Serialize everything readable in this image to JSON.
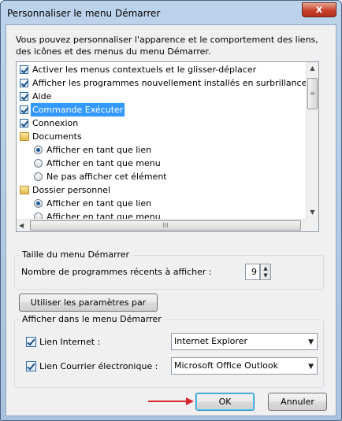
{
  "window": {
    "title": "Personnaliser le menu Démarrer",
    "close_label": "x"
  },
  "description": "Vous pouvez personnaliser l'apparence et le comportement des liens, des icônes et des menus du menu Démarrer.",
  "list": {
    "items": [
      {
        "type": "checkbox",
        "label": "Activer les menus contextuels et le glisser-déplacer",
        "checked": true
      },
      {
        "type": "checkbox",
        "label": "Afficher les programmes nouvellement installés en surbrillance",
        "checked": true
      },
      {
        "type": "checkbox",
        "label": "Aide",
        "checked": true
      },
      {
        "type": "checkbox",
        "label": "Commande Exécuter",
        "checked": true,
        "selected": true
      },
      {
        "type": "checkbox",
        "label": "Connexion",
        "checked": true
      },
      {
        "type": "folder",
        "label": "Documents"
      },
      {
        "type": "radio",
        "label": "Afficher en tant que lien",
        "checked": true
      },
      {
        "type": "radio",
        "label": "Afficher en tant que menu",
        "checked": false
      },
      {
        "type": "radio",
        "label": "Ne pas afficher cet élément",
        "checked": false
      },
      {
        "type": "folder",
        "label": "Dossier personnel"
      },
      {
        "type": "radio",
        "label": "Afficher en tant que lien",
        "checked": true
      },
      {
        "type": "radio",
        "label": "Afficher en tant que menu",
        "checked": false
      }
    ],
    "scroll_grip": "≡",
    "hscroll_grip": "III"
  },
  "size_group": {
    "title": "Taille du menu Démarrer",
    "recent_label": "Nombre de programmes récents à afficher :",
    "recent_value": "9"
  },
  "defaults_button": "Utiliser les paramètres par défaut",
  "show_group": {
    "title": "Afficher dans le menu Démarrer",
    "internet_label": "Lien Internet :",
    "internet_value": "Internet Explorer",
    "email_label": "Lien Courrier électronique :",
    "email_value": "Microsoft Office Outlook"
  },
  "buttons": {
    "ok": "OK",
    "cancel": "Annuler"
  },
  "colors": {
    "selection": "#3399ff",
    "annotation_arrow": "#d9232d"
  }
}
